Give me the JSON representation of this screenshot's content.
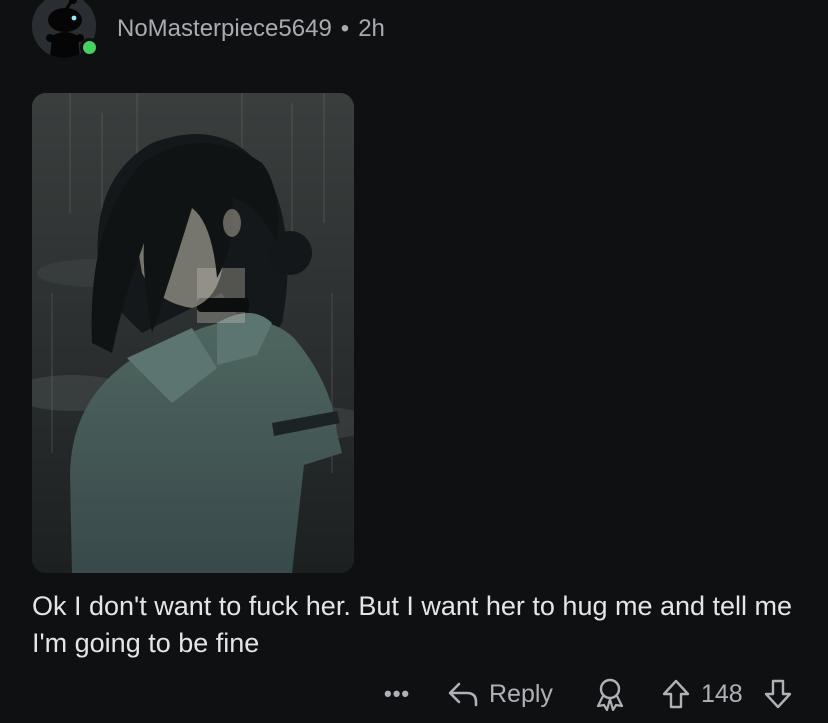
{
  "comment": {
    "username": "NoMasterpiece5649",
    "separator": "•",
    "time_ago": "2h",
    "body": "Ok I don't want to fuck her. But I want her to hug me and tell me I'm going to be fine",
    "online": true
  },
  "actions": {
    "more_label": "•••",
    "reply_label": "Reply",
    "vote_count": "148"
  },
  "icons": {
    "avatar": "snoo-avatar-icon",
    "reply": "reply-arrow-icon",
    "award": "award-icon",
    "upvote": "upvote-arrow-icon",
    "downvote": "downvote-arrow-icon"
  },
  "colors": {
    "background": "#0e1012",
    "online": "#46d160",
    "meta_text": "#a8acb0",
    "body_text": "#e3e6e8"
  }
}
